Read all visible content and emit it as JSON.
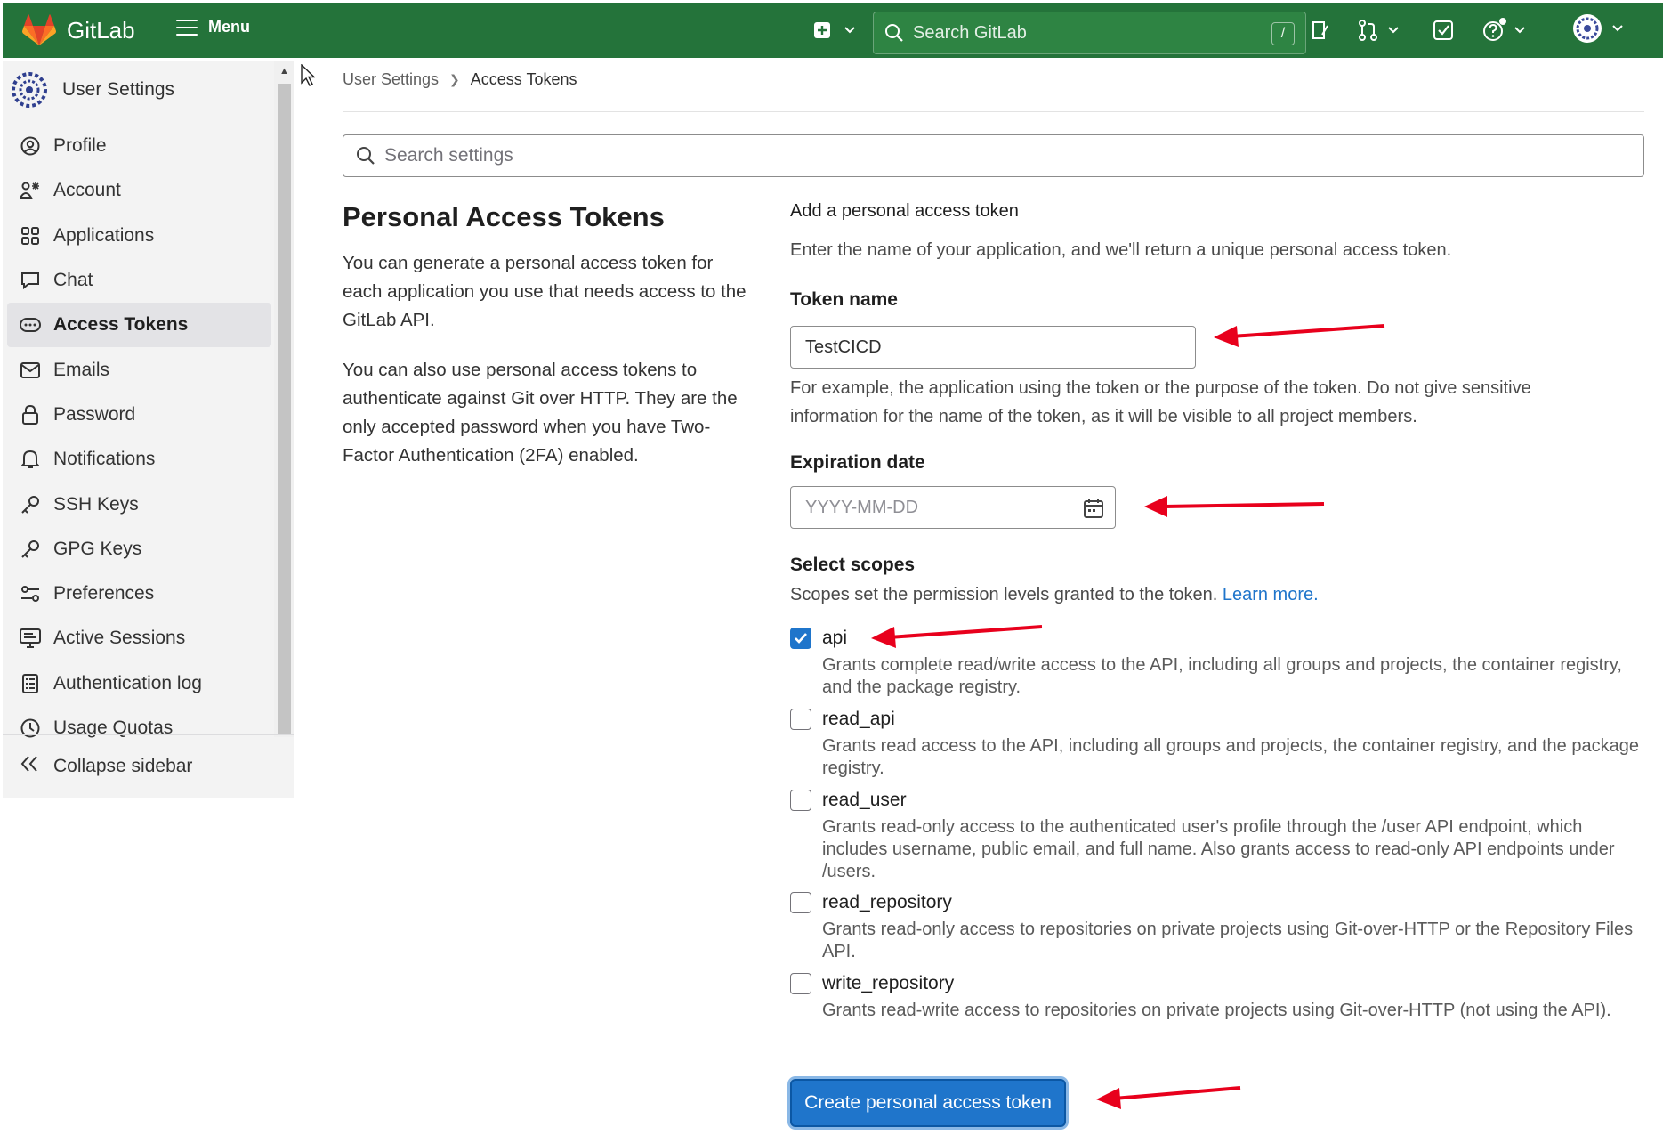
{
  "topbar": {
    "brand": "GitLab",
    "menu_label": "Menu",
    "search_placeholder": "Search GitLab",
    "search_shortcut": "/",
    "icons": [
      "plus-square-icon",
      "chevron-down-icon",
      "issues-icon",
      "merge-request-icon",
      "todo-icon",
      "help-icon",
      "user-avatar"
    ]
  },
  "sidebar": {
    "title": "User Settings",
    "items": [
      {
        "label": "Profile",
        "icon": "profile-icon",
        "active": false
      },
      {
        "label": "Account",
        "icon": "account-icon",
        "active": false
      },
      {
        "label": "Applications",
        "icon": "applications-icon",
        "active": false
      },
      {
        "label": "Chat",
        "icon": "chat-icon",
        "active": false
      },
      {
        "label": "Access Tokens",
        "icon": "token-icon",
        "active": true
      },
      {
        "label": "Emails",
        "icon": "mail-icon",
        "active": false
      },
      {
        "label": "Password",
        "icon": "lock-icon",
        "active": false
      },
      {
        "label": "Notifications",
        "icon": "bell-icon",
        "active": false
      },
      {
        "label": "SSH Keys",
        "icon": "key-icon",
        "active": false
      },
      {
        "label": "GPG Keys",
        "icon": "key-icon",
        "active": false
      },
      {
        "label": "Preferences",
        "icon": "preferences-icon",
        "active": false
      },
      {
        "label": "Active Sessions",
        "icon": "monitor-icon",
        "active": false
      },
      {
        "label": "Authentication log",
        "icon": "log-icon",
        "active": false
      },
      {
        "label": "Usage Quotas",
        "icon": "quota-icon",
        "active": false
      }
    ],
    "collapse_label": "Collapse sidebar"
  },
  "breadcrumb": {
    "parent": "User Settings",
    "current": "Access Tokens"
  },
  "settings_search_placeholder": "Search settings",
  "intro": {
    "title": "Personal Access Tokens",
    "p1": "You can generate a personal access token for each application you use that needs access to the GitLab API.",
    "p2": "You can also use personal access tokens to authenticate against Git over HTTP. They are the only accepted password when you have Two-Factor Authentication (2FA) enabled."
  },
  "form": {
    "heading": "Add a personal access token",
    "subheading": "Enter the name of your application, and we'll return a unique personal access token.",
    "token_name_label": "Token name",
    "token_name_value": "TestCICD",
    "token_name_help": "For example, the application using the token or the purpose of the token. Do not give sensitive information for the name of the token, as it will be visible to all project members.",
    "expiration_label": "Expiration date",
    "expiration_placeholder": "YYYY-MM-DD",
    "scopes_label": "Select scopes",
    "scopes_help": "Scopes set the permission levels granted to the token.",
    "learn_more": "Learn more.",
    "scopes": [
      {
        "name": "api",
        "checked": true,
        "desc": "Grants complete read/write access to the API, including all groups and projects, the container registry, and the package registry."
      },
      {
        "name": "read_api",
        "checked": false,
        "desc": "Grants read access to the API, including all groups and projects, the container registry, and the package registry."
      },
      {
        "name": "read_user",
        "checked": false,
        "desc": "Grants read-only access to the authenticated user's profile through the /user API endpoint, which includes username, public email, and full name. Also grants access to read-only API endpoints under /users."
      },
      {
        "name": "read_repository",
        "checked": false,
        "desc": "Grants read-only access to repositories on private projects using Git-over-HTTP or the Repository Files API."
      },
      {
        "name": "write_repository",
        "checked": false,
        "desc": "Grants read-write access to repositories on private projects using Git-over-HTTP (not using the API)."
      }
    ],
    "submit_label": "Create personal access token"
  },
  "colors": {
    "topbar": "#24733a",
    "primary": "#1f75cb",
    "annotation_arrow": "#e8001c"
  }
}
